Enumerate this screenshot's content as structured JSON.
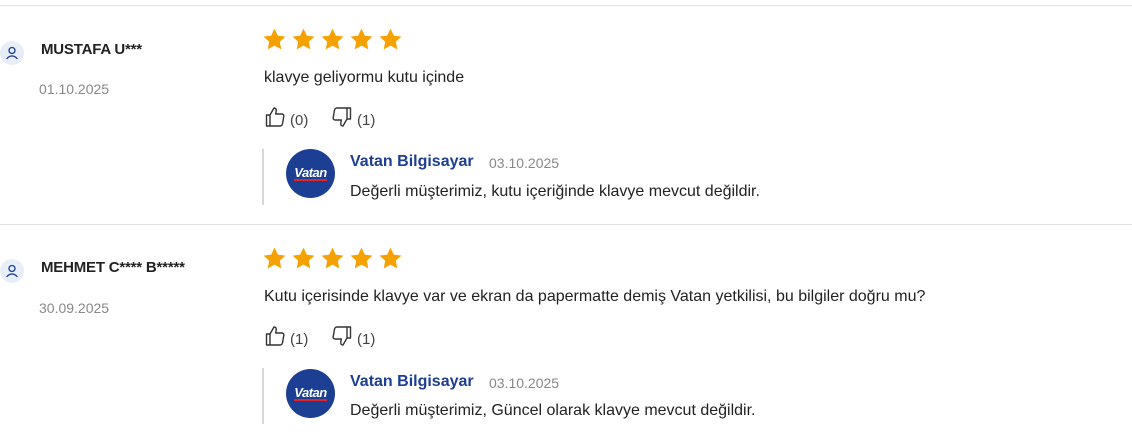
{
  "reviews": [
    {
      "user": "MUSTAFA U***",
      "date": "01.10.2025",
      "rating": 5,
      "comment": "klavye geliyormu kutu içinde",
      "likes": "(0)",
      "dislikes": "(1)",
      "reply": {
        "logo_text": "Vatan",
        "name": "Vatan Bilgisayar",
        "date": "03.10.2025",
        "text": "Değerli müşterimiz, kutu içeriğinde klavye mevcut değildir."
      }
    },
    {
      "user": "MEHMET C**** B*****",
      "date": "30.09.2025",
      "rating": 5,
      "comment": "Kutu içerisinde klavye var ve ekran da papermatte demiş Vatan yetkilisi, bu bilgiler doğru mu?",
      "likes": "(1)",
      "dislikes": "(1)",
      "reply": {
        "logo_text": "Vatan",
        "name": "Vatan Bilgisayar",
        "date": "03.10.2025",
        "text": "Değerli müşterimiz, Güncel olarak klavye mevcut değildir."
      }
    }
  ],
  "colors": {
    "star": "#f5a100",
    "brand": "#1c3f93",
    "muted": "#888888"
  },
  "icons": {
    "avatar": "user-icon",
    "star": "star-icon",
    "like": "thumbs-up-icon",
    "dislike": "thumbs-down-icon"
  }
}
